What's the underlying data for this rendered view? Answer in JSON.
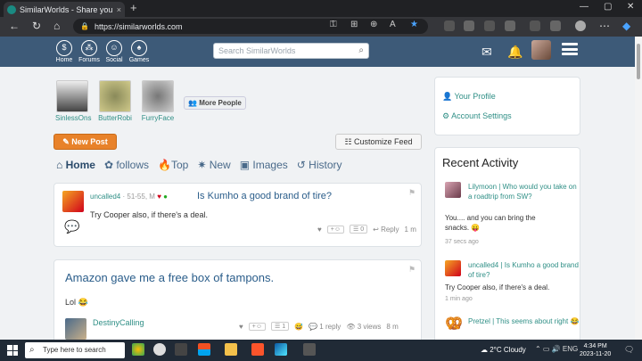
{
  "browser": {
    "tab_title": "SimilarWorlds - Share your Expe",
    "tab_close": "×",
    "new_tab": "+",
    "url": "https://similarworlds.com",
    "win_min": "—",
    "win_max": "▢",
    "win_close": "✕"
  },
  "nav": {
    "items": [
      {
        "label": "Home",
        "icon": "$"
      },
      {
        "label": "Forums",
        "icon": "⁂"
      },
      {
        "label": "Social",
        "icon": "☺"
      },
      {
        "label": "Games",
        "icon": "♠"
      }
    ],
    "search_placeholder": "Search SimilarWorlds"
  },
  "people": [
    {
      "name": "SinlessOns"
    },
    {
      "name": "ButterRobi"
    },
    {
      "name": "FurryFace"
    }
  ],
  "more_people": "More People",
  "new_post": "New Post",
  "customize_feed": "Customize Feed",
  "feed_tabs": [
    "Home",
    "follows",
    "Top",
    "New",
    "Images",
    "History"
  ],
  "posts": [
    {
      "user": "uncalled4",
      "meta": "· 51-55, M",
      "title": "Is Kumho a good brand of tire?",
      "text": "Try Cooper also, if there's a deal.",
      "count": "0",
      "reply": "Reply",
      "time": "1 m"
    },
    {
      "title": "Amazon gave me a free box of tampons.",
      "text": "Lol",
      "commenter": "DestinyCalling",
      "count": "1",
      "replies": "1 reply",
      "views": "3 views",
      "time": "8 m"
    }
  ],
  "right": {
    "your_profile": "Your Profile",
    "account_settings": "Account Settings",
    "recent_title": "Recent Activity",
    "activity": [
      {
        "user": "Lilymoon",
        "text": "Who would you take on a roadtrip from SW?",
        "body": "You.... and you can bring the snacks.",
        "time": "37 secs ago"
      },
      {
        "user": "uncalled4",
        "text": "Is Kumho a good brand of tire?",
        "body": "Try Cooper also, if there's a deal.",
        "time": "1 min ago"
      },
      {
        "user": "Pretzel",
        "text": "This seems about right",
        "body": "",
        "time": ""
      }
    ]
  },
  "taskbar": {
    "search": "Type here to search",
    "weather": "2°C  Cloudy",
    "lang": "ENG",
    "time": "4:34 PM",
    "date": "2023-11-20"
  },
  "colors": {
    "accent": "#2f8f86",
    "header": "#3d5a78",
    "orange": "#e8822a"
  }
}
